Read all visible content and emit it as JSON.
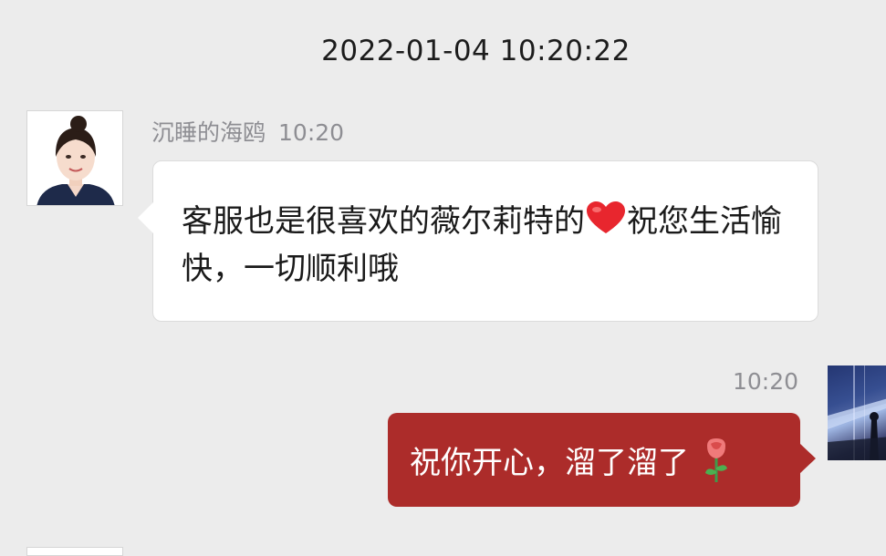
{
  "chat": {
    "timestamp": "2022-01-04 10:20:22",
    "received": {
      "sender": "沉睡的海鸥",
      "time": "10:20",
      "text_part1": "客服也是很喜欢的薇尔莉特的",
      "text_part2": "祝您生活愉快，一切顺利哦",
      "emoji": "heart-icon",
      "emoji_color": "#e8262e"
    },
    "sent": {
      "time": "10:20",
      "text": "祝你开心，溜了溜了",
      "emoji": "rose-icon",
      "bubble_color": "#ac2c2a"
    }
  }
}
